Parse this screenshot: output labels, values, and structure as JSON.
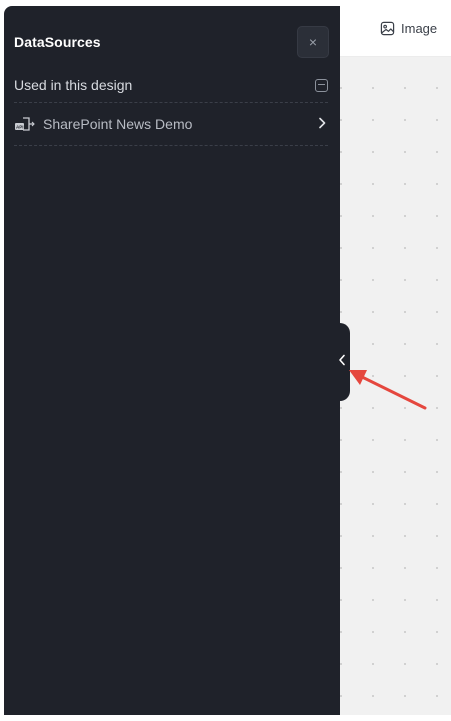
{
  "canvas": {
    "toolbar": {
      "image_label": "Image",
      "image_icon": "image-icon"
    }
  },
  "panel": {
    "title": "DataSources",
    "close_label": "×",
    "section": {
      "label": "Used in this design",
      "collapse_icon": "minus-square-icon"
    },
    "sources": [
      {
        "label": "SharePoint News Demo",
        "icon": "api-icon",
        "chevron": "chevron-right-icon"
      }
    ]
  },
  "handle": {
    "icon": "chevron-left-icon"
  },
  "annotation": {
    "color": "#e5473e"
  }
}
